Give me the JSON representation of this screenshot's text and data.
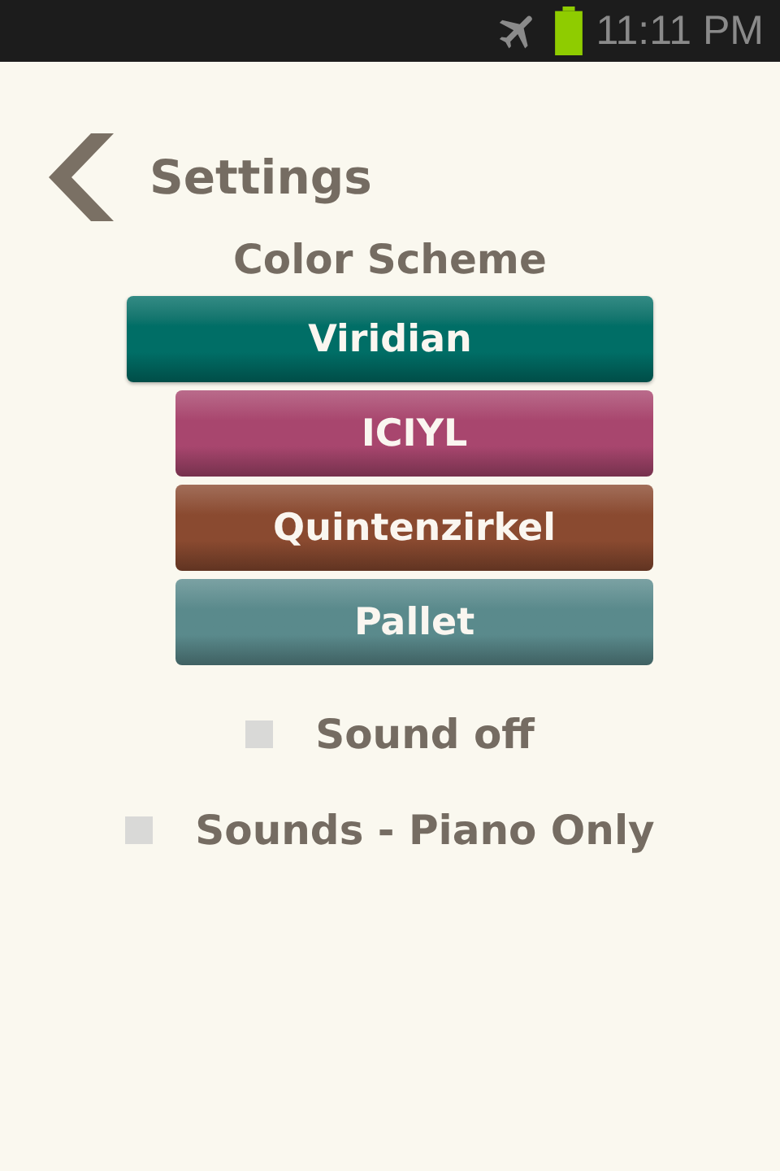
{
  "status_bar": {
    "time": "11:11 PM"
  },
  "header": {
    "title": "Settings"
  },
  "color_scheme": {
    "heading": "Color Scheme",
    "schemes": [
      {
        "label": "Viridian",
        "selected": true,
        "color": "#006e66"
      },
      {
        "label": "ICIYL",
        "selected": false,
        "color": "#a8466e"
      },
      {
        "label": "Quintenzirkel",
        "selected": false,
        "color": "#8a4a30"
      },
      {
        "label": "Pallet",
        "selected": false,
        "color": "#5a8a8c"
      }
    ]
  },
  "options": [
    {
      "label": "Sound off",
      "checked": false
    },
    {
      "label": "Sounds - Piano Only",
      "checked": false
    }
  ]
}
